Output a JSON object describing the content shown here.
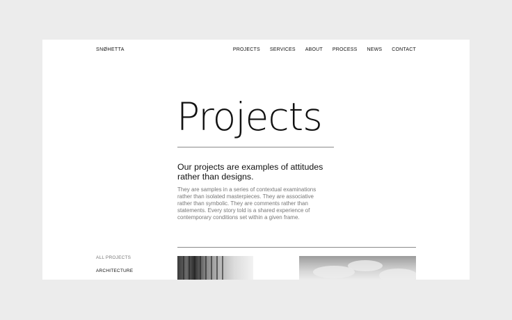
{
  "header": {
    "logo": "SNØHETTA",
    "nav": [
      "PROJECTS",
      "SERVICES",
      "ABOUT",
      "PROCESS",
      "NEWS",
      "CONTACT"
    ]
  },
  "hero": {
    "title": "Projects",
    "lead": "Our projects are examples of attitudes rather than designs.",
    "body": "They are samples in a series of contextual examinations rather than isolated masterpieces. They are associative rather than symbolic. They are comments rather than statements. Every story told is a shared experience of contemporary conditions set within a given frame."
  },
  "filters": {
    "all": "ALL PROJECTS",
    "architecture": "ARCHITECTURE"
  }
}
